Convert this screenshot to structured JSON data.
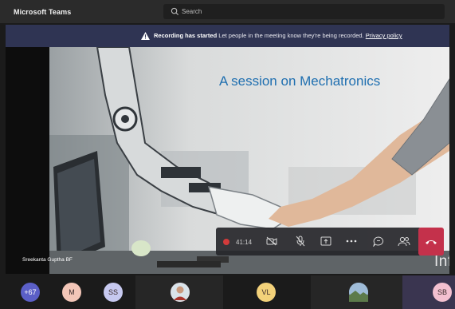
{
  "titlebar": {
    "app_title": "Microsoft Teams",
    "search_placeholder": "Search"
  },
  "banner": {
    "bold_text": "Recording has started",
    "message": "Let people in the meeting know they're being recorded.",
    "link": "Privacy policy"
  },
  "stage": {
    "slide_title": "A session on Mechatronics",
    "presenter_name": "Sreekanta Guptha BF",
    "brand_text": "Infosys"
  },
  "controls": {
    "timer": "41:14",
    "buttons": [
      "camera-off-icon",
      "mic-off-icon",
      "share-icon",
      "more-icon",
      "chat-icon",
      "participants-icon",
      "hangup-icon"
    ]
  },
  "participants": [
    {
      "label": "+67",
      "color": "#5b5fc7"
    },
    {
      "label": "M",
      "color": "#f3c6b8"
    },
    {
      "label": "SS",
      "color": "#c7c9f0"
    },
    {
      "label": "",
      "color": "#b8362f"
    },
    {
      "label": "VL",
      "color": "#f3d27a"
    },
    {
      "label": "",
      "color": "#7fa0c8"
    },
    {
      "label": "SB",
      "color": "#f3c0d0"
    }
  ],
  "colors": {
    "banner_bg": "#2f3453",
    "hangup": "#c4314b",
    "recording_dot": "#d23b3b",
    "slide_title": "#1f6fb0"
  }
}
